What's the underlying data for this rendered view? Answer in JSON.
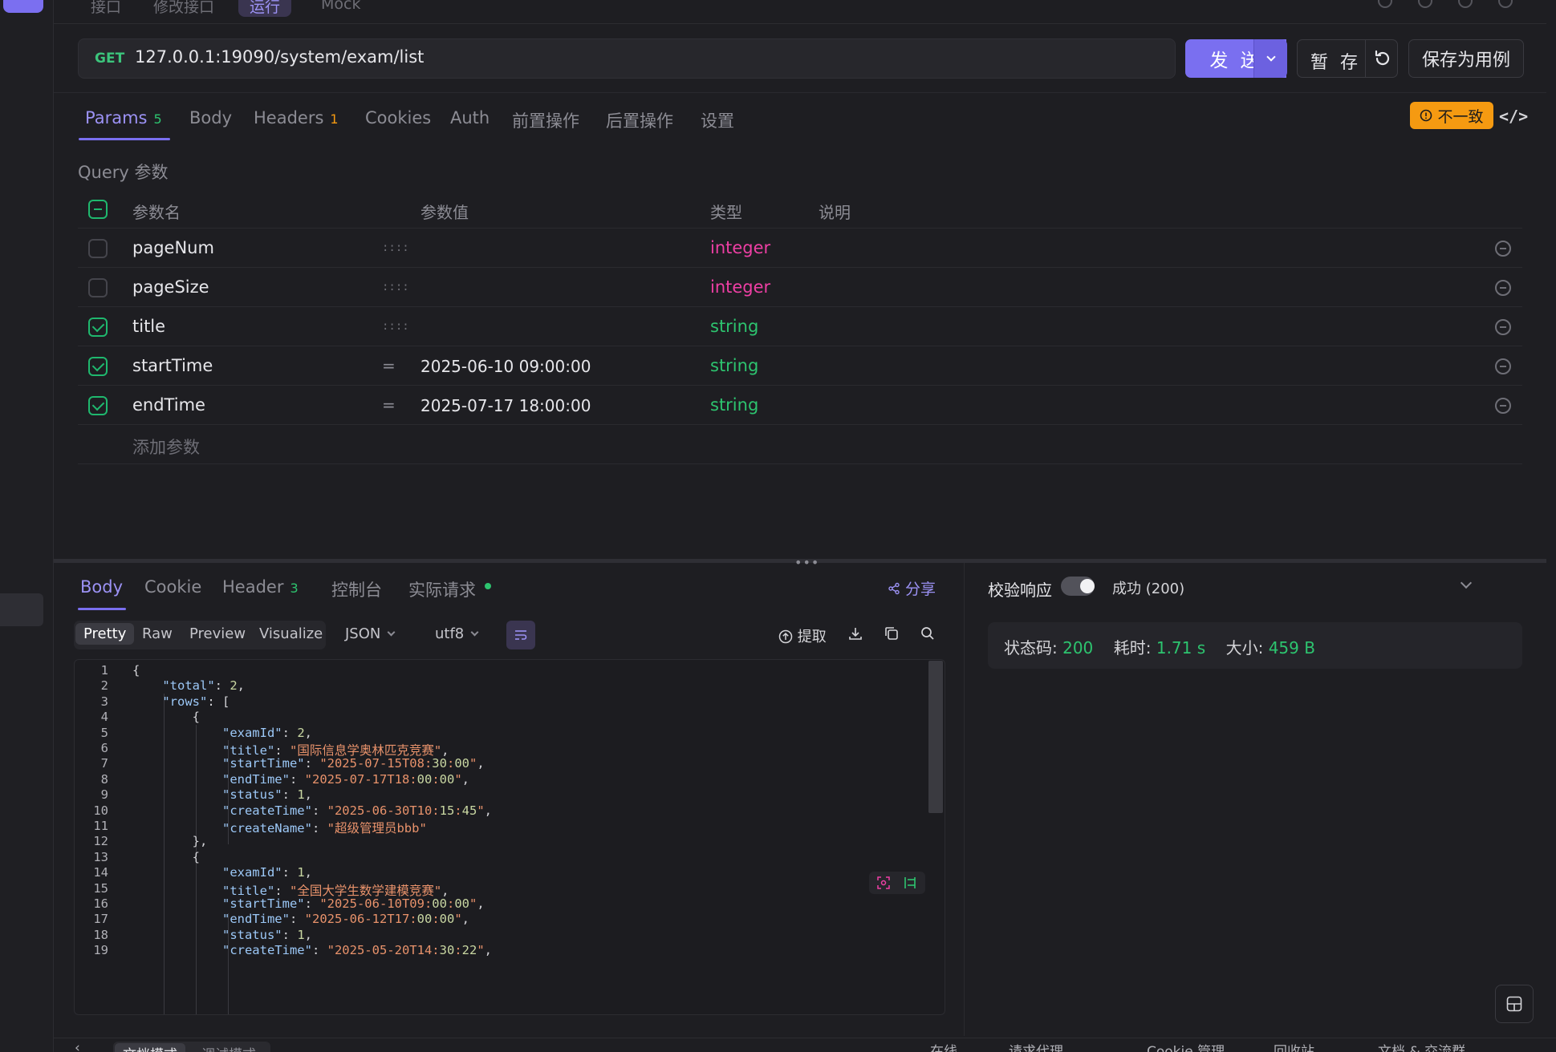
{
  "top_tabs": [
    "接口",
    "修改接口",
    "运行",
    "Mock"
  ],
  "request": {
    "method": "GET",
    "url": "127.0.0.1:19090/system/exam/list",
    "send_label": "发 送",
    "stash_label": "暂 存",
    "save_case_label": "保存为用例"
  },
  "req_tabs": [
    {
      "label": "Params",
      "count": "5"
    },
    {
      "label": "Body",
      "count": ""
    },
    {
      "label": "Headers",
      "count": "1"
    },
    {
      "label": "Cookies",
      "count": ""
    },
    {
      "label": "Auth",
      "count": ""
    },
    {
      "label": "前置操作",
      "count": ""
    },
    {
      "label": "后置操作",
      "count": ""
    },
    {
      "label": "设置",
      "count": ""
    }
  ],
  "mismatch_label": "不一致",
  "query": {
    "section_label": "Query 参数",
    "headers": {
      "name": "参数名",
      "value": "参数值",
      "type": "类型",
      "desc": "说明"
    },
    "params": [
      {
        "name": "pageNum",
        "value": "",
        "type": "integer",
        "checked": false
      },
      {
        "name": "pageSize",
        "value": "",
        "type": "integer",
        "checked": false
      },
      {
        "name": "title",
        "value": "",
        "type": "string",
        "checked": true
      },
      {
        "name": "startTime",
        "value": "2025-06-10 09:00:00",
        "type": "string",
        "checked": true
      },
      {
        "name": "endTime",
        "value": "2025-07-17 18:00:00",
        "type": "string",
        "checked": true
      }
    ],
    "add_placeholder": "添加参数"
  },
  "response_tabs": [
    {
      "label": "Body",
      "count": ""
    },
    {
      "label": "Cookie",
      "count": ""
    },
    {
      "label": "Header",
      "count": "3"
    },
    {
      "label": "控制台",
      "count": ""
    },
    {
      "label": "实际请求",
      "count": ""
    }
  ],
  "share_label": "分享",
  "view_modes": [
    "Pretty",
    "Raw",
    "Preview",
    "Visualize"
  ],
  "format": "JSON",
  "encoding": "utf8",
  "extract_label": "提取",
  "code_lines": [
    "{",
    "    \"total\": 2,",
    "    \"rows\": [",
    "        {",
    "            \"examId\": 2,",
    "            \"title\": \"国际信息学奥林匹克竞赛\",",
    "            \"startTime\": \"2025-07-15T08:30:00\",",
    "            \"endTime\": \"2025-07-17T18:00:00\",",
    "            \"status\": 1,",
    "            \"createTime\": \"2025-06-30T10:15:45\",",
    "            \"createName\": \"超级管理员bbb\"",
    "        },",
    "        {",
    "            \"examId\": 1,",
    "            \"title\": \"全国大学生数学建模竞赛\",",
    "            \"startTime\": \"2025-06-10T09:00:00\",",
    "            \"endTime\": \"2025-06-12T17:00:00\",",
    "            \"status\": 1,",
    "            \"createTime\": \"2025-05-20T14:30:22\","
  ],
  "validate": {
    "label": "校验响应",
    "result": "成功 (200)"
  },
  "status": {
    "code_label": "状态码:",
    "code": "200",
    "time_label": "耗时:",
    "time": "1.71 s",
    "size_label": "大小:",
    "size": "459 B"
  },
  "bottom": {
    "modes": [
      "文档模式",
      "调试模式"
    ],
    "items": [
      "在线",
      "请求代理",
      "Cookie 管理",
      "回收站",
      "文档 & 交流群"
    ]
  }
}
